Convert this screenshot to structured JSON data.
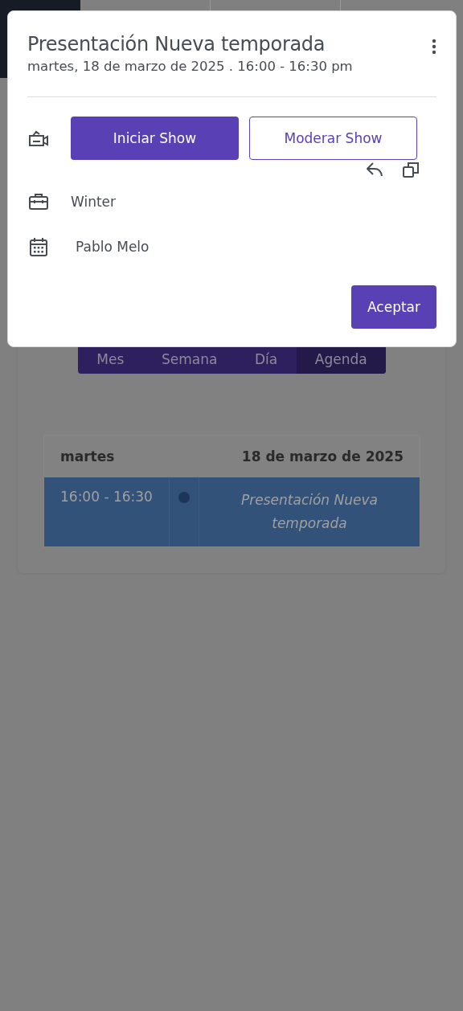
{
  "event": {
    "title": "Presentación Nueva temporada",
    "datetime": "martes, 18 de marzo de 2025 . 16:00 - 16:30 pm",
    "actions": [
      {
        "label": "Iniciar Show",
        "kind": "primary"
      },
      {
        "label": "Moderar Show",
        "kind": "outline"
      }
    ],
    "details": [
      {
        "kind": "briefcase",
        "text": "Winter"
      },
      {
        "kind": "calendar",
        "text": "Pablo Melo"
      }
    ],
    "confirm": "Aceptar"
  },
  "calendar": {
    "views": [
      {
        "label": "Mes",
        "selected": false
      },
      {
        "label": "Semana",
        "selected": false
      },
      {
        "label": "Día",
        "selected": false
      },
      {
        "label": "Agenda",
        "selected": true
      }
    ],
    "agenda": {
      "day": "martes",
      "date": "18 de marzo de 2025",
      "events": [
        {
          "time": "16:00 - 16:30",
          "title": "Presentación Nueva temporada"
        }
      ]
    }
  }
}
